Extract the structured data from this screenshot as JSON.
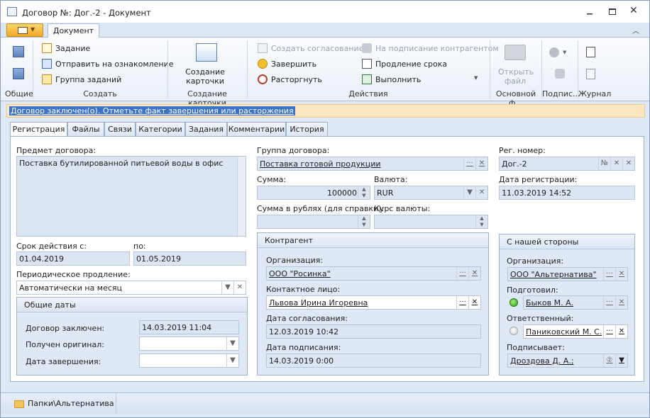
{
  "window": {
    "title": "Договор №: Дог.-2 - Документ"
  },
  "ribbon": {
    "tab": "Документ",
    "groups": {
      "general": "Общие",
      "create": "Создать",
      "card": "Создание карточки",
      "actions": "Действия",
      "main_file": "Основной ф...",
      "sign": "Подпис...",
      "journal": "Журнал"
    },
    "create_items": [
      "Задание",
      "Отправить на ознакомление",
      "Группа заданий"
    ],
    "card_button": "Создание карточки",
    "actions_col1": [
      "Создать согласование",
      "Завершить",
      "Расторгнуть"
    ],
    "actions_col2": [
      "На подписание контрагентом",
      "Продление срока",
      "Выполнить"
    ],
    "open_file": "Открыть файл"
  },
  "notice": "Договор заключен(о). Отметьте факт завершения или расторжения",
  "tabs": [
    "Регистрация",
    "Файлы",
    "Связи",
    "Категории",
    "Задания",
    "Комментарии",
    "История"
  ],
  "form": {
    "subject_label": "Предмет договора:",
    "subject": "Поставка бутилированной питьевой воды в офис",
    "valid_from_label": "Срок действия с:",
    "valid_from": "01.04.2019",
    "valid_to_label": "по:",
    "valid_to": "01.05.2019",
    "renewal_label": "Периодическое продление:",
    "renewal": "Автоматически на  месяц",
    "group_label": "Группа договора:",
    "group": "Поставка готовой продукции",
    "sum_label": "Сумма:",
    "sum": "100000",
    "currency_label": "Валюта:",
    "currency": "RUR",
    "sum_rub_label": "Сумма в рублях (для справки):",
    "rate_label": "Курс валюты:",
    "reg_no_label": "Рег. номер:",
    "reg_no": "Дог.-2",
    "reg_no_btn": "№",
    "reg_date_label": "Дата регистрации:",
    "reg_date": "11.03.2019 14:52"
  },
  "common_dates": {
    "title": "Общие даты",
    "concluded_label": "Договор заключен:",
    "concluded": "14.03.2019 11:04",
    "original_label": "Получен оригинал:",
    "completion_label": "Дата завершения:"
  },
  "counterparty": {
    "title": "Контрагент",
    "org_label": "Организация:",
    "org": "ООО \"Росинка\"",
    "contact_label": "Контактное лицо:",
    "contact": "Львова Ирина Игоревна",
    "approve_label": "Дата согласования:",
    "approve": "12.03.2019 10:42",
    "sign_label": "Дата подписания:",
    "sign": "14.03.2019 0:00"
  },
  "our_side": {
    "title": "С нашей стороны",
    "org_label": "Организация:",
    "org": "ООО \"Альтернатива\"",
    "prepared_label": "Подготовил:",
    "prepared": "Быков М. А.",
    "responsible_label": "Ответственный:",
    "responsible": "Паниковский М. С.",
    "signer_label": "Подписывает:",
    "signer": "Дроздова Д. А.;"
  },
  "statusbar": {
    "folder": "Папки\\Альтернатива"
  },
  "colors": {
    "accent": "#3a73c9",
    "notice_bg": "#fde7c0",
    "panel": "#dfe8f5"
  }
}
